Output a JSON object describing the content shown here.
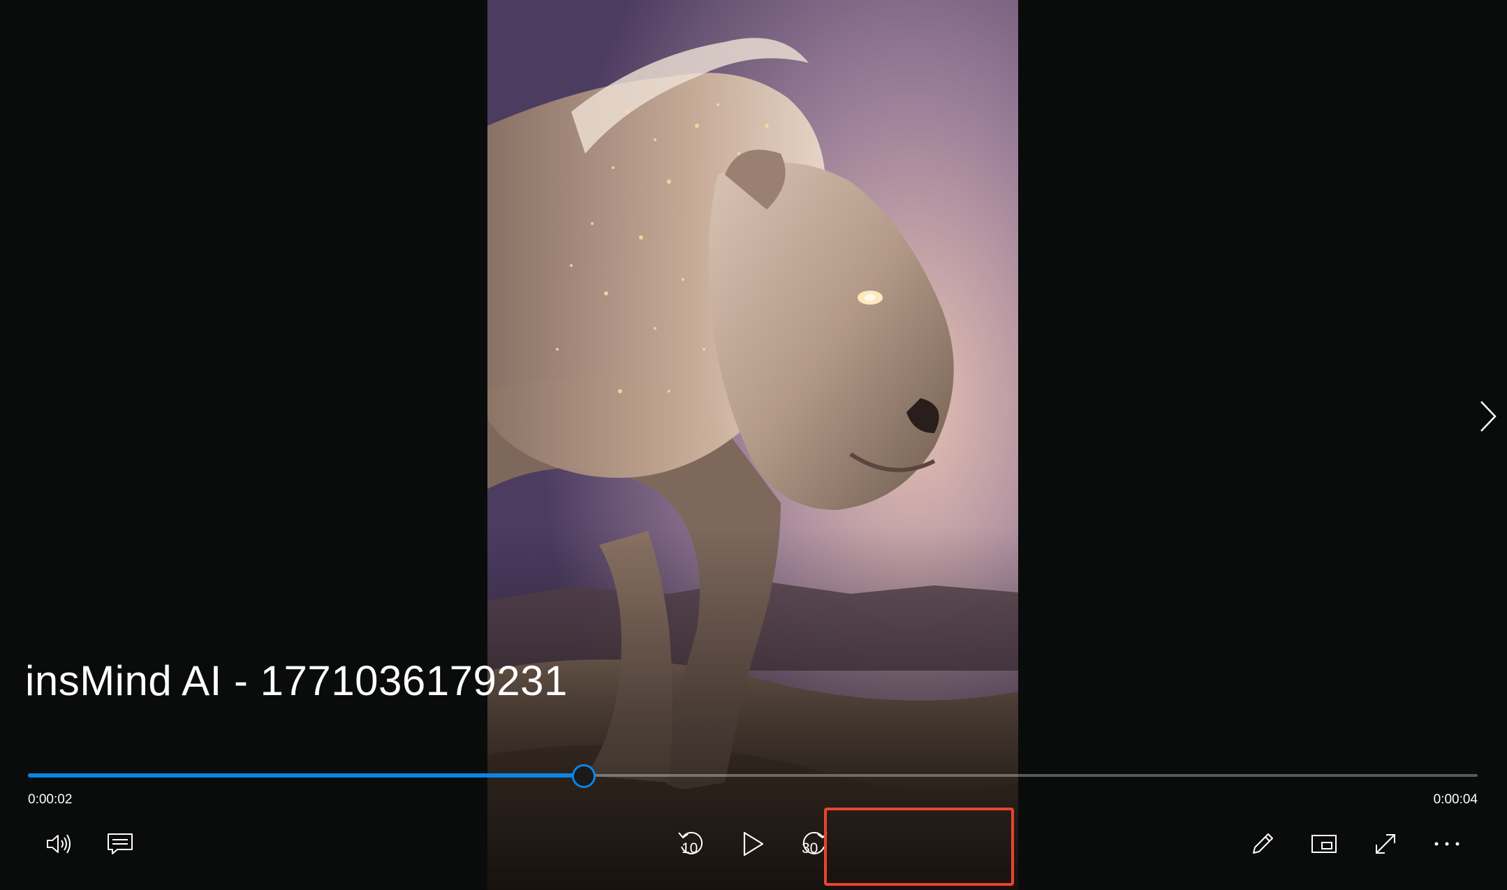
{
  "video": {
    "title": "insMind AI - 1771036179231",
    "subject": "lion"
  },
  "playback": {
    "elapsed": "0:00:02",
    "total": "0:00:04",
    "progress_fraction": 0.383
  },
  "controls": {
    "skip_back_seconds": "10",
    "skip_forward_seconds": "30",
    "icons": {
      "volume": "volume-icon",
      "captions": "captions-icon",
      "skip_back": "skip-back-10-icon",
      "play": "play-icon",
      "skip_forward": "skip-forward-30-icon",
      "edit": "pencil-icon",
      "miniview": "mini-view-icon",
      "fullscreen": "fullscreen-icon",
      "more": "more-icon",
      "next": "chevron-right-icon"
    }
  },
  "colors": {
    "accent": "#0a84e8",
    "background": "#0a0c0b",
    "highlight": "#e8452c"
  }
}
